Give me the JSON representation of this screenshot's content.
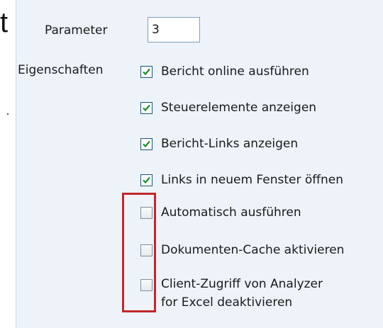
{
  "left_fragment": {
    "text": "t"
  },
  "parameter": {
    "label": "Parameter",
    "value": "3"
  },
  "properties": {
    "label": "Eigenschaften",
    "options": [
      {
        "label": "Bericht online ausführen",
        "checked": true
      },
      {
        "label": "Steuerelemente anzeigen",
        "checked": true
      },
      {
        "label": "Bericht-Links anzeigen",
        "checked": true
      },
      {
        "label": "Links in neuem Fenster öffnen",
        "checked": true
      },
      {
        "label": "Automatisch ausführen",
        "checked": false
      },
      {
        "label": "Dokumenten-Cache aktivieren",
        "checked": false
      },
      {
        "label_line1": "Client-Zugriff von Analyzer",
        "label_line2": "for Excel deaktivieren",
        "checked": false
      }
    ]
  },
  "colors": {
    "panel_bg": "#eef3fa",
    "checkmark": "#1e8a2e",
    "highlight": "#c0282d"
  }
}
